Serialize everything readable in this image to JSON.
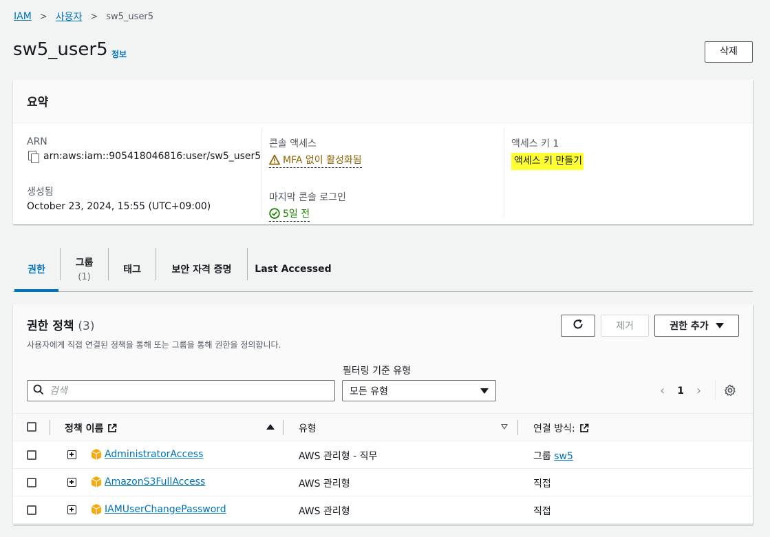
{
  "breadcrumb": {
    "items": [
      "IAM",
      "사용자"
    ],
    "current": "sw5_user5"
  },
  "header": {
    "title": "sw5_user5",
    "info_label": "정보",
    "delete_label": "삭제"
  },
  "summary": {
    "title": "요약",
    "arn_label": "ARN",
    "arn_value": "arn:aws:iam::905418046816:user/sw5_user5",
    "created_label": "생성됨",
    "created_value": "October 23, 2024, 15:55 (UTC+09:00)",
    "console_access_label": "콘솔 액세스",
    "console_access_value": "MFA 없이 활성화됨",
    "last_login_label": "마지막 콘솔 로그인",
    "last_login_value": "5일 전",
    "access_key_label": "액세스 키 1",
    "access_key_action": "액세스 키 만들기"
  },
  "tabs": [
    {
      "label": "권한",
      "sub": "",
      "active": true
    },
    {
      "label": "그룹",
      "sub": "(1)",
      "active": false
    },
    {
      "label": "태그",
      "sub": "",
      "active": false
    },
    {
      "label": "보안 자격 증명",
      "sub": "",
      "active": false
    },
    {
      "label": "Last Accessed",
      "sub": "",
      "active": false
    }
  ],
  "permissions": {
    "title": "권한 정책",
    "count": "(3)",
    "description": "사용자에게 직접 연결된 정책을 통해 또는 그룹을 통해 권한을 정의합니다.",
    "remove_label": "제거",
    "add_label": "권한 추가",
    "filter_label": "필터링 기준 유형",
    "search_placeholder": "검색",
    "filter_selected": "모든 유형",
    "page": "1",
    "columns": {
      "name": "정책 이름",
      "type": "유형",
      "attached": "연결 방식:"
    },
    "rows": [
      {
        "name": "AdministratorAccess",
        "type": "AWS 관리형 - 직무",
        "attached_prefix": "그룹",
        "attached_link": "sw5",
        "attached_text": ""
      },
      {
        "name": "AmazonS3FullAccess",
        "type": "AWS 관리형",
        "attached_prefix": "",
        "attached_link": "",
        "attached_text": "직접"
      },
      {
        "name": "IAMUserChangePassword",
        "type": "AWS 관리형",
        "attached_prefix": "",
        "attached_link": "",
        "attached_text": "직접"
      }
    ]
  },
  "colors": {
    "link": "#0073bb",
    "warning": "#8d6605",
    "success": "#1d8102",
    "highlight": "#ffff33",
    "policy_icon": "#f7a80c"
  },
  "icons": [
    "copy-icon",
    "warning-icon",
    "check-circle-icon",
    "refresh-icon",
    "caret-down-icon",
    "search-icon",
    "chevron-left-icon",
    "chevron-right-icon",
    "gear-icon",
    "external-link-icon",
    "expand-icon",
    "policy-cube-icon"
  ]
}
